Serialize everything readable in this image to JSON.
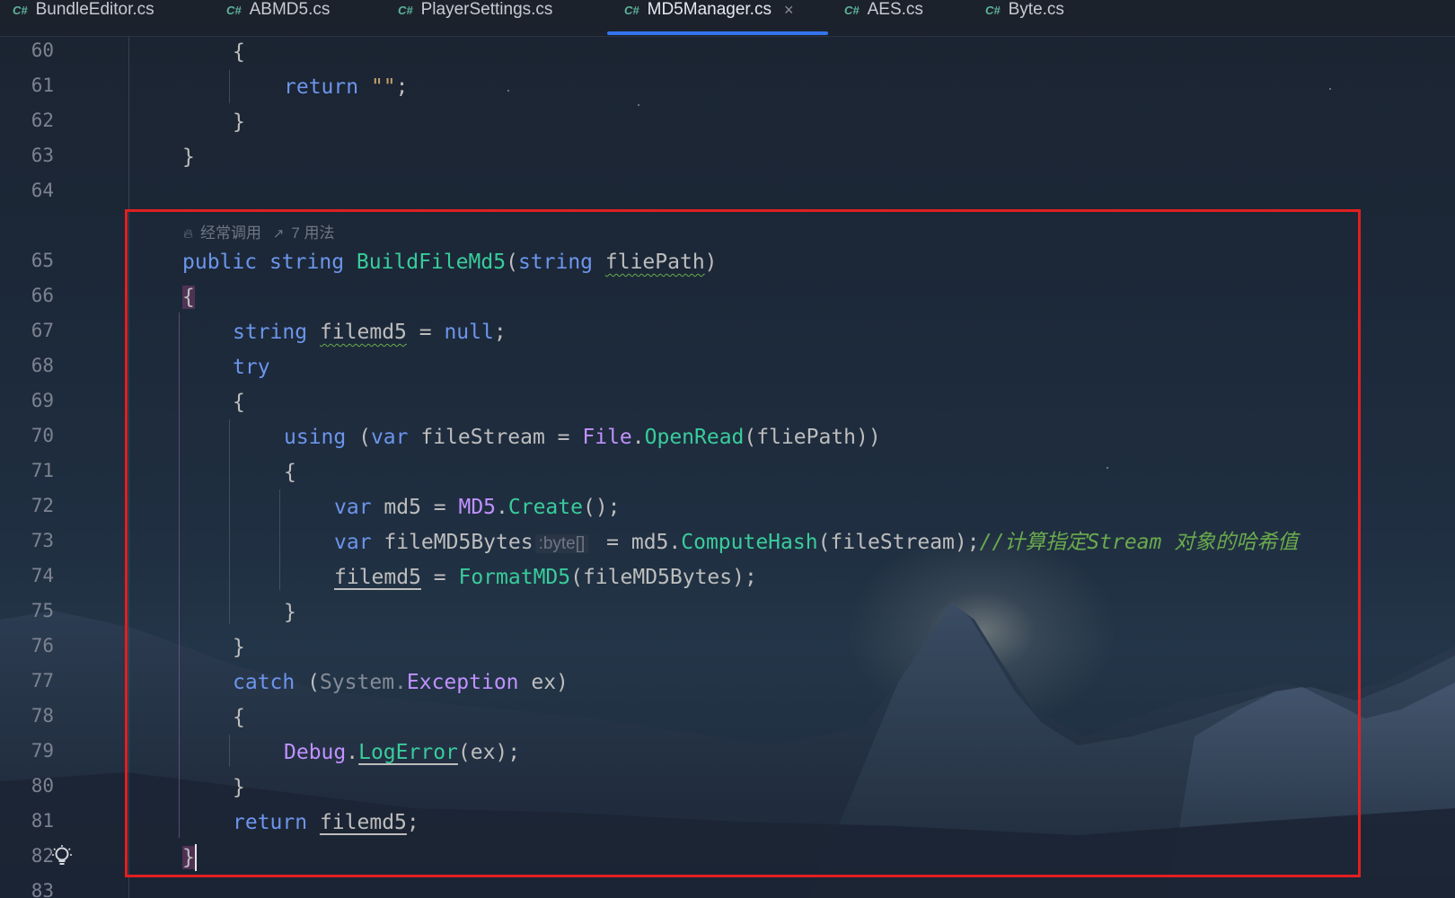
{
  "tabs": [
    {
      "lang": "C#",
      "label": "BundleEditor.cs",
      "active": false
    },
    {
      "lang": "C#",
      "label": "ABMD5.cs",
      "active": false
    },
    {
      "lang": "C#",
      "label": "PlayerSettings.cs",
      "active": false
    },
    {
      "lang": "C#",
      "label": "MD5Manager.cs",
      "active": true,
      "close": "×"
    },
    {
      "lang": "C#",
      "label": "AES.cs",
      "active": false
    },
    {
      "lang": "C#",
      "label": "Byte.cs",
      "active": false
    }
  ],
  "gutter": {
    "line_numbers": [
      "60",
      "61",
      "62",
      "63",
      "64",
      "65",
      "66",
      "67",
      "68",
      "69",
      "70",
      "71",
      "72",
      "73",
      "74",
      "75",
      "76",
      "77",
      "78",
      "79",
      "80",
      "81",
      "82",
      "83"
    ]
  },
  "code_vision": {
    "frequent": "经常调用",
    "usages": "7 用法"
  },
  "code": {
    "l60": {
      "t1": "{"
    },
    "l61": {
      "t1": "return",
      "t2": " ",
      "t3": "\"\"",
      "t4": ";"
    },
    "l62": {
      "t1": "}"
    },
    "l63": {
      "t1": "}"
    },
    "l65": {
      "t1": "public",
      "t2": " ",
      "t3": "string",
      "t4": " ",
      "t5": "BuildFileMd5",
      "t6": "(",
      "t7": "string",
      "t8": " ",
      "t9": "fliePath",
      "t10": ")"
    },
    "l66": {
      "t1": "{"
    },
    "l67": {
      "t1": "string",
      "t2": " ",
      "t3": "filemd5",
      "t4": " = ",
      "t5": "null",
      "t6": ";"
    },
    "l68": {
      "t1": "try"
    },
    "l69": {
      "t1": "{"
    },
    "l70": {
      "t1": "using",
      "t2": " (",
      "t3": "var",
      "t4": " fileStream = ",
      "t5": "File",
      "t6": ".",
      "t7": "OpenRead",
      "t8": "(fliePath))"
    },
    "l71": {
      "t1": "{"
    },
    "l72": {
      "t1": "var",
      "t2": " md5 = ",
      "t3": "MD5",
      "t4": ".",
      "t5": "Create",
      "t6": "();"
    },
    "l73": {
      "t1": "var",
      "t2": " fileMD5Bytes",
      "t3": ":byte[]",
      "t4": " = md5.",
      "t5": "ComputeHash",
      "t6": "(fileStream);",
      "t7": "//计算指定Stream 对象的哈希值"
    },
    "l74": {
      "t1": "filemd5",
      "t2": " = ",
      "t3": "FormatMD5",
      "t4": "(fileMD5Bytes);"
    },
    "l75": {
      "t1": "}"
    },
    "l76": {
      "t1": "}"
    },
    "l77": {
      "t1": "catch",
      "t2": " (",
      "t3": "System.",
      "t4": "Exception",
      "t5": " ex)"
    },
    "l78": {
      "t1": "{"
    },
    "l79": {
      "t1": "Debug",
      "t2": ".",
      "t3": "LogError",
      "t4": "(ex);"
    },
    "l80": {
      "t1": "}"
    },
    "l81": {
      "t1": "return",
      "t2": " ",
      "t3": "filemd5",
      "t4": ";"
    },
    "l82": {
      "t1": "}"
    }
  },
  "icons": {
    "flame": "flame-icon",
    "usage": "usages-icon",
    "bulb": "lightbulb-icon",
    "close": "close-icon"
  },
  "colors": {
    "keyword": "#6c95eb",
    "string": "#c9a26d",
    "method": "#39cc9b",
    "class": "#c191ff",
    "comment": "#6aaa4d",
    "highlight_box": "#e02020",
    "tab_underline": "#3574f0"
  }
}
